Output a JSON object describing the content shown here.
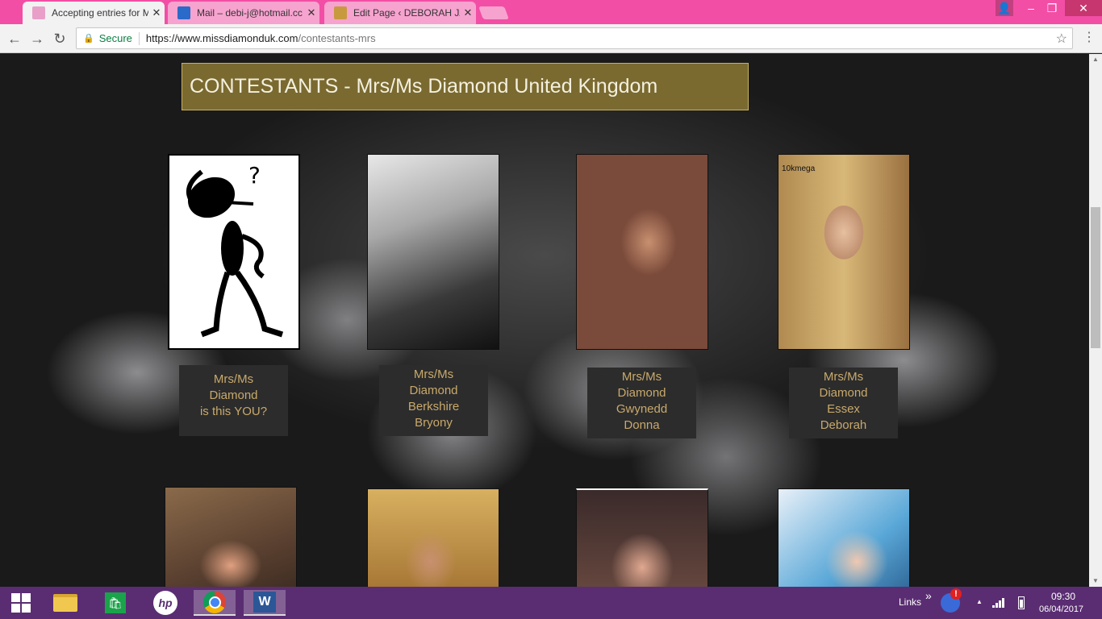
{
  "browser": {
    "tabs": [
      {
        "title": "Accepting entries for Mis",
        "favicon_color": "#e8a0c8",
        "active": true
      },
      {
        "title": "Mail – debi-j@hotmail.cc",
        "favicon_color": "#2a6ac8",
        "active": false
      },
      {
        "title": "Edit Page ‹ DEBORAH JA",
        "favicon_color": "#c89a40",
        "active": false
      }
    ],
    "tab_close": "✕",
    "window_controls": {
      "user": "👤",
      "minimize": "–",
      "restore": "❐",
      "close": "✕"
    },
    "nav": {
      "back": "←",
      "forward": "→",
      "reload": "↻"
    },
    "address": {
      "lock": "🔒",
      "secure_label": "Secure",
      "host": "https://www.missdiamonduk.com",
      "path": "/contestants-mrs"
    },
    "star": "☆",
    "menu": "⋮"
  },
  "page": {
    "heading": "CONTESTANTS - Mrs/Ms Diamond United Kingdom",
    "contestants": [
      {
        "caption": [
          "Mrs/Ms",
          "Diamond",
          "is this YOU?"
        ],
        "photo": "question-man-drawing"
      },
      {
        "caption": [
          "Mrs/Ms",
          "Diamond",
          "Berkshire",
          "Bryony"
        ],
        "photo": "black-white-portrait"
      },
      {
        "caption": [
          "Mrs/Ms",
          "Diamond",
          "Gwynedd",
          "Donna"
        ],
        "photo": "portrait-sequin-dress"
      },
      {
        "caption": [
          "Mrs/Ms",
          "Diamond",
          "Essex",
          "Deborah"
        ],
        "photo": "portrait-teal-dress",
        "photo_label": "10kmega"
      }
    ],
    "second_row_photos": [
      "portrait-cowboy-hat",
      "portrait-smiling-woman",
      "portrait-close-up",
      "portrait-blue-hair"
    ]
  },
  "scrollbar": {
    "up": "▲",
    "down": "▼"
  },
  "taskbar": {
    "links_label": "Links",
    "chevron": "»",
    "tray_up": "▲",
    "time": "09:30",
    "date": "06/04/2017",
    "word_letter": "W",
    "hp_label": "hp",
    "store_glyph": "🛍",
    "alert": "!"
  },
  "colors": {
    "titlebar": "#f24ea5",
    "heading_bg": "#7a6a30",
    "caption_text": "#c9a96b",
    "taskbar": "#5a2d72"
  }
}
